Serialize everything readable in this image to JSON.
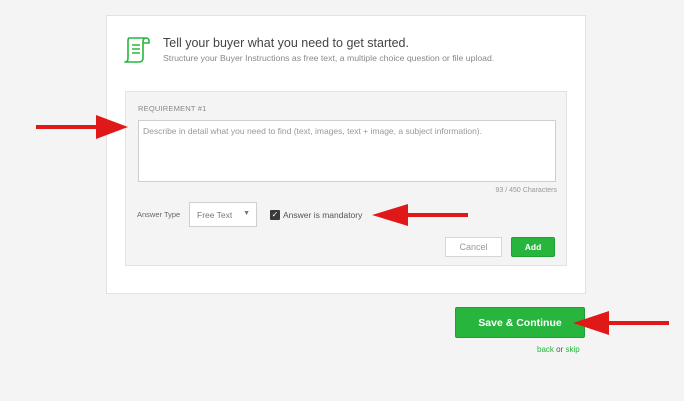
{
  "header": {
    "title": "Tell your buyer what you need to get started.",
    "subtitle": "Structure your Buyer Instructions as free text, a multiple choice question or file upload.",
    "icon": "scroll-document-icon",
    "accent_color": "#27b53e"
  },
  "requirement": {
    "label": "REQUIREMENT #1",
    "placeholder": "Describe in detail what you need to find (text, images, text + image, a subject information).",
    "char_count": "93 / 450 Characters",
    "answer_type_label": "Answer Type",
    "answer_type_value": "Free Text",
    "mandatory_label": "Answer is mandatory",
    "mandatory_checked": true,
    "cancel_label": "Cancel",
    "add_label": "Add"
  },
  "footer": {
    "save_label": "Save & Continue",
    "back_label": "back",
    "or_label": "or",
    "skip_label": "skip"
  },
  "annotations": {
    "arrow_color": "#e01818"
  }
}
